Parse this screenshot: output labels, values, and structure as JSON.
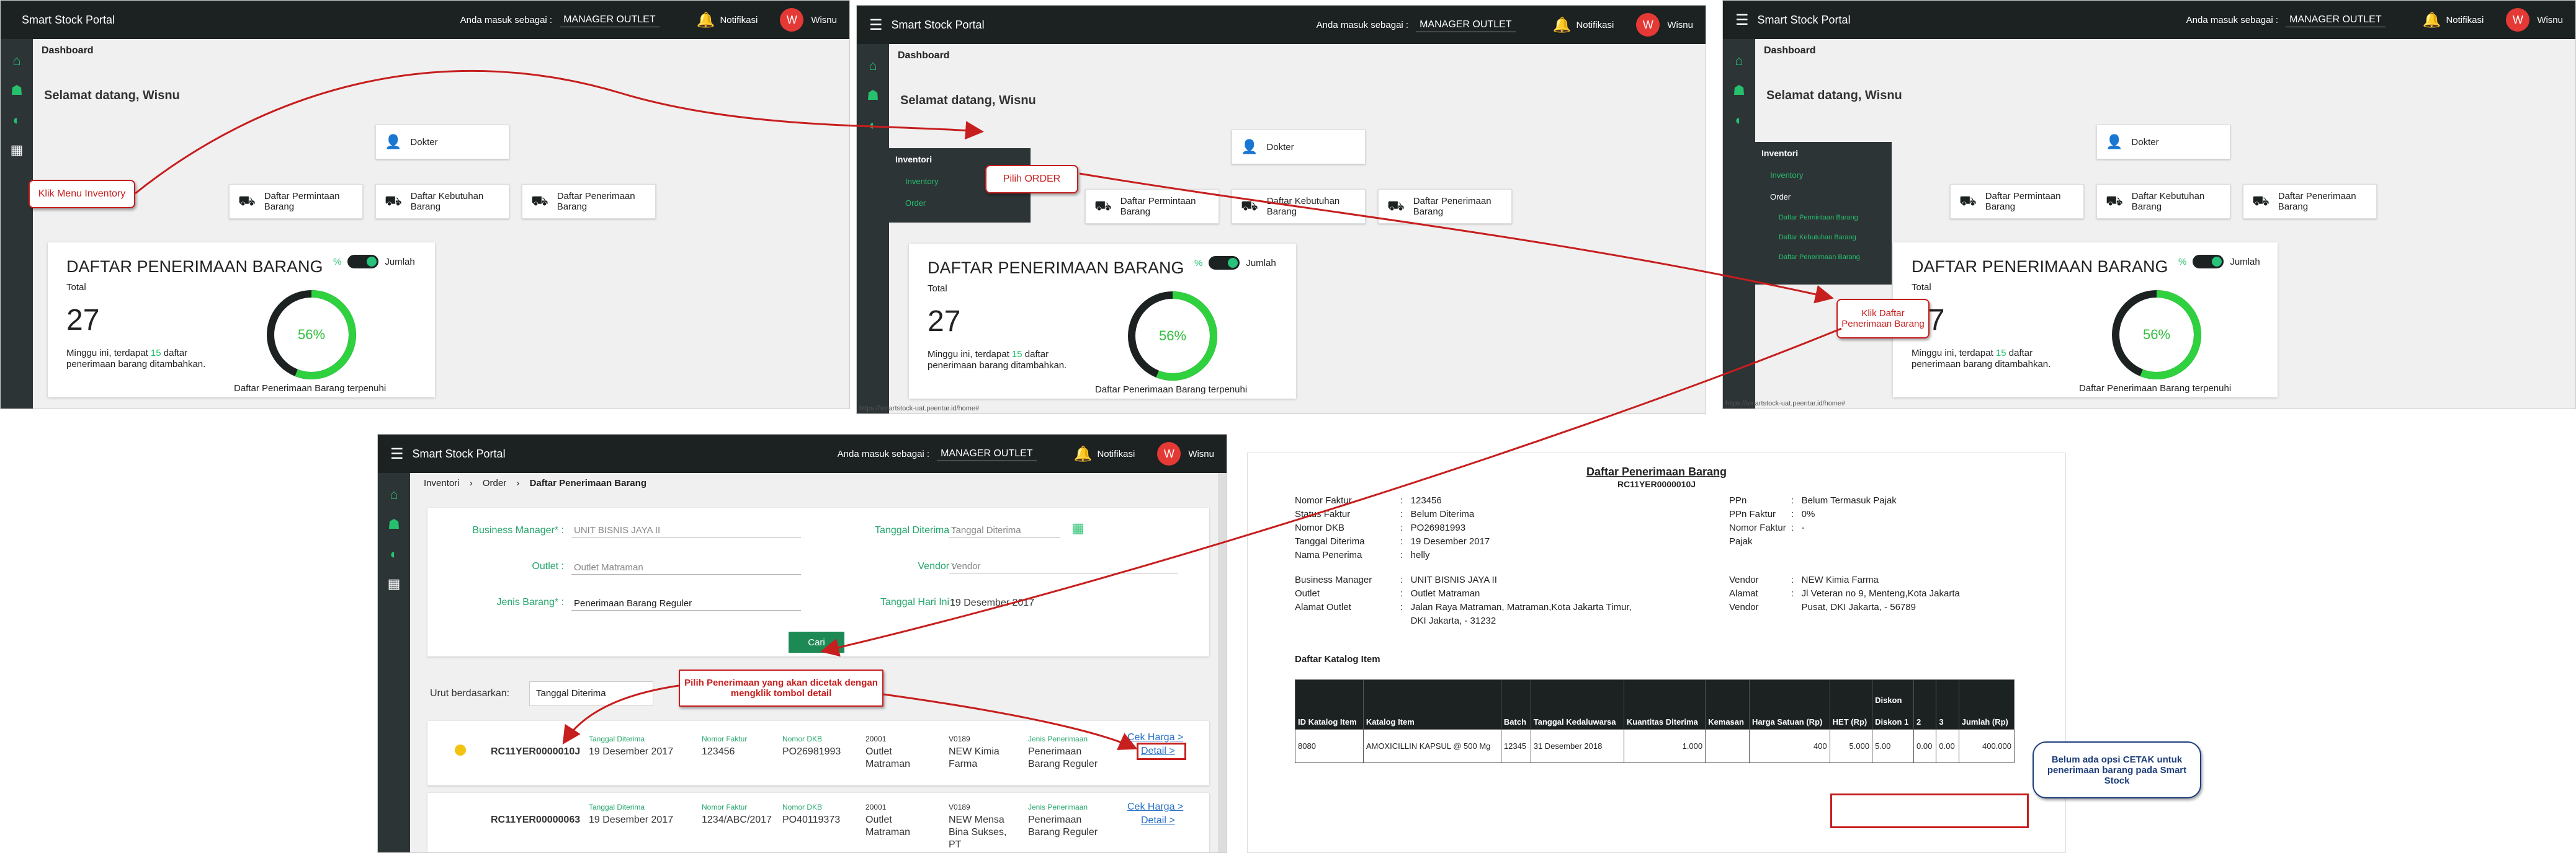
{
  "app": {
    "title": "Smart Stock Portal",
    "role_label": "Anda masuk sebagai :",
    "role": "MANAGER OUTLET",
    "notif": "Notifikasi",
    "user": "Wisnu",
    "avatar_letter": "W"
  },
  "dashboard": {
    "breadcrumb": "Dashboard",
    "welcome": "Selamat datang, Wisnu",
    "tiles": [
      "Dokter",
      "Daftar Permintaan Barang",
      "Daftar Kebutuhan Barang",
      "Daftar Penerimaan Barang"
    ],
    "card": {
      "title": "DAFTAR PENERIMAAN BARANG",
      "toggle_pct": "%",
      "toggle_label": "Jumlah",
      "total_label": "Total",
      "total": "27",
      "info_pre": "Minggu ini, terdapat ",
      "info_num": "15",
      "info_post": " daftar penerimaan barang ditambahkan.",
      "percent": "56%",
      "percent_value": 56,
      "footer": "Daftar Penerimaan Barang terpenuhi"
    }
  },
  "menu": {
    "inventori": "Inventori",
    "inventory": "Inventory",
    "order": "Order",
    "sub": [
      "Daftar Permintaan Barang",
      "Daftar Kebutuhan Barang",
      "Daftar Penerimaan Barang"
    ]
  },
  "status_url": "https://smartstock-uat.peentar.id/home#",
  "callouts": {
    "c1": "Klik Menu Inventory",
    "c2": "Pilih ORDER",
    "c3": "Klik Daftar Penerimaan Barang",
    "c4": "Pilih Penerimaan yang akan dicetak dengan mengklik tombol detail",
    "c5": "Belum ada opsi CETAK untuk penerimaan barang pada Smart Stock"
  },
  "form": {
    "breadcrumb": [
      "Inventori",
      "Order",
      "Daftar Penerimaan Barang"
    ],
    "bm_label": "Business Manager* :",
    "bm_value": "UNIT BISNIS JAYA II",
    "outlet_label": "Outlet :",
    "outlet_value": "Outlet Matraman",
    "jenis_label": "Jenis Barang* :",
    "jenis_value": "Penerimaan Barang Reguler",
    "tgl_label": "Tanggal Diterima :",
    "tgl_placeholder": "Tanggal Diterima",
    "vendor_label": "Vendor :",
    "vendor_placeholder": "Vendor",
    "hari_label": "Tanggal Hari Ini :",
    "hari_value": "19 Desember 2017",
    "cari": "Cari",
    "sort_label": "Urut berdasarkan:",
    "sort_value": "Tanggal Diterima",
    "col_labels": {
      "tgl": "Tanggal Diterima",
      "faktur": "Nomor Faktur",
      "dkb": "Nomor DKB",
      "jenis": "Jenis Penerimaan"
    },
    "rows": [
      {
        "id": "RC11YER0000010J",
        "tgl": "19 Desember 2017",
        "faktur": "123456",
        "dkb": "PO26981993",
        "code1": "20001",
        "outlet": "Outlet Matraman",
        "code2": "V0189",
        "vendor": "NEW Kimia Farma",
        "jenis": "Penerimaan Barang Reguler",
        "cek": "Cek Harga >",
        "detail": "Detail >"
      },
      {
        "id": "RC11YER00000063",
        "tgl": "19 Desember 2017",
        "faktur": "1234/ABC/2017",
        "dkb": "PO40119373",
        "code1": "20001",
        "outlet": "Outlet Matraman",
        "code2": "V0189",
        "vendor": "NEW Mensa Bina Sukses, PT",
        "jenis": "Penerimaan Barang Reguler",
        "cek": "Cek Harga >",
        "detail": "Detail >"
      }
    ]
  },
  "doc": {
    "title": "Daftar Penerimaan Barang",
    "code": "RC11YER0000010J",
    "left1": "Nomor Faktur\nStatus Faktur\nNomor DKB\nTanggal Diterima\nNama Penerima",
    "left1v": ":   123456\n:   Belum Diterima\n:   PO26981993\n:   19 Desember 2017\n:   helly",
    "right1": "PPn\nPPn Faktur\nNomor Faktur\nPajak",
    "right1v": ":   Belum Termasuk Pajak\n:   0%\n:   -",
    "left2": "Business Manager\nOutlet\nAlamat Outlet",
    "left2v": ":   UNIT BISNIS JAYA II\n:   Outlet Matraman\n:   Jalan Raya Matraman, Matraman,Kota Jakarta Timur,\n    DKI Jakarta, - 31232",
    "right2": "Vendor\nAlamat\nVendor",
    "right2v": ":   NEW Kimia Farma\n:   Jl Veteran no 9, Menteng,Kota Jakarta\n    Pusat, DKI Jakarta, - 56789",
    "katalog": "Daftar Katalog Item",
    "headers": [
      "ID Katalog Item",
      "Katalog Item",
      "Batch",
      "Tanggal Kedaluwarsa",
      "Kuantitas Diterima",
      "Kemasan",
      "Harga Satuan (Rp)",
      "HET (Rp)",
      "Diskon 1",
      "2",
      "3",
      "Jumlah (Rp)"
    ],
    "diskon": "Diskon",
    "row": [
      "8080",
      "AMOXICILLIN KAPSUL @ 500 Mg",
      "12345",
      "31 Desember 2018",
      "1.000",
      "",
      "400",
      "5.000",
      "5.00",
      "0.00",
      "0.00",
      "400.000"
    ]
  }
}
